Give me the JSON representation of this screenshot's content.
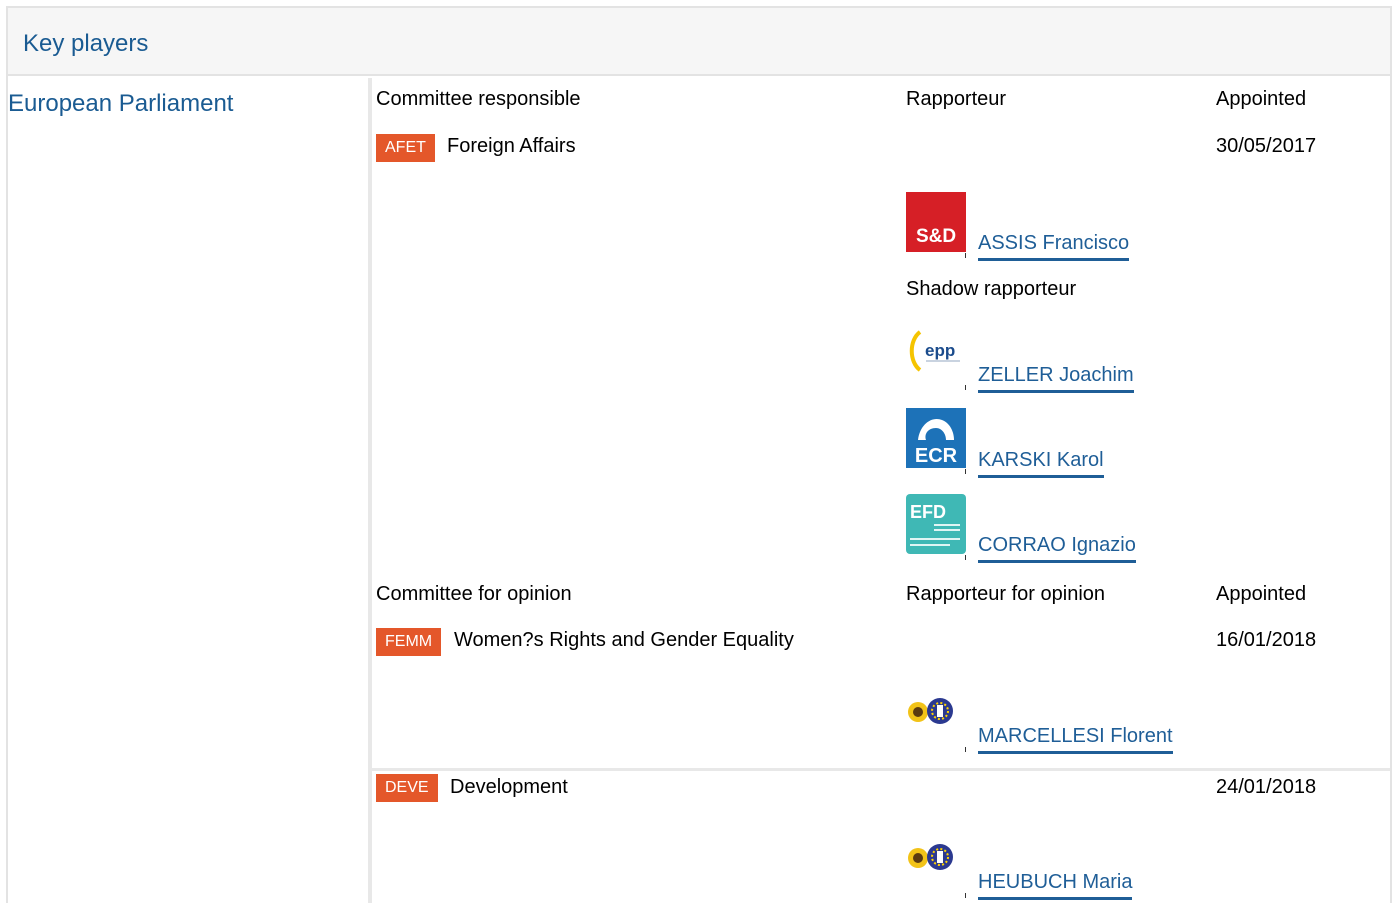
{
  "header": {
    "title": "Key players"
  },
  "institution": {
    "name": "European Parliament"
  },
  "responsible": {
    "col_committee": "Committee responsible",
    "col_rapporteur": "Rapporteur",
    "col_appointed": "Appointed",
    "committee": {
      "abbr": "AFET",
      "name": "Foreign Affairs",
      "date": "30/05/2017"
    },
    "rapporteur": {
      "name": "ASSIS Francisco",
      "group_logo": "S&D"
    },
    "shadow_label": "Shadow rapporteur",
    "shadows": [
      {
        "name": "ZELLER Joachim",
        "group_logo": "epp"
      },
      {
        "name": "KARSKI Karol",
        "group_logo": "ECR"
      },
      {
        "name": "CORRAO Ignazio",
        "group_logo": "EFD"
      }
    ]
  },
  "opinion": {
    "col_committee": "Committee for opinion",
    "col_rapporteur": "Rapporteur for opinion",
    "col_appointed": "Appointed",
    "committees": [
      {
        "abbr": "FEMM",
        "name": "Women?s Rights and Gender Equality",
        "date": "16/01/2018",
        "rapporteur": "MARCELLESI Florent",
        "group_logo": "greens-efa-icon"
      },
      {
        "abbr": "DEVE",
        "name": "Development",
        "date": "24/01/2018",
        "rapporteur": "HEUBUCH Maria",
        "group_logo": "greens-efa-icon"
      }
    ]
  },
  "colors": {
    "link": "#1f5e97",
    "badge": "#e4572a",
    "header_bg": "#f6f6f6"
  }
}
